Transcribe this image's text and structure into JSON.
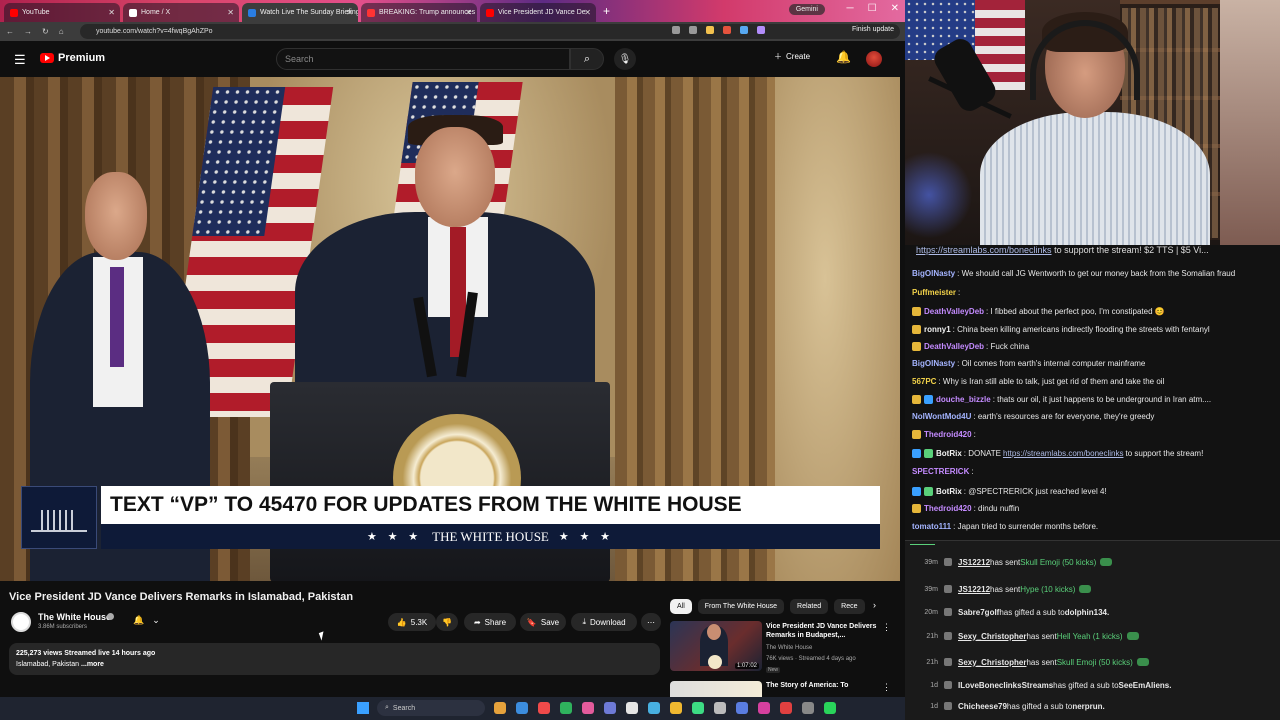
{
  "browser": {
    "tabs": [
      {
        "title": "YouTube",
        "color": "#ff0000"
      },
      {
        "title": "Home / X",
        "color": "#ffffff"
      },
      {
        "title": "Watch Live The Sunday Briefing",
        "color": "#2a7de1"
      },
      {
        "title": "BREAKING: Trump announces",
        "color": "#ff3333"
      },
      {
        "title": "Vice President JD Vance De",
        "color": "#ff0000"
      }
    ],
    "gemini_label": "Gemini",
    "url": "youtube.com/watch?v=4fwqBgAhZPo",
    "finish_update": "Finish update"
  },
  "yt": {
    "brand": "Premium",
    "search_placeholder": "Search",
    "create_label": "Create"
  },
  "video": {
    "lower_third_headline": "TEXT “VP” TO 45470 FOR UPDATES FROM THE WHITE HOUSE",
    "lower_third_sub": "THE WHITE HOUSE",
    "stars": "★ ★ ★"
  },
  "meta": {
    "title": "Vice President JD Vance Delivers Remarks in Islamabad, Pakistan",
    "channel": "The White House",
    "subscribers": "3.86M subscribers",
    "likes": "5.3K",
    "share_label": "Share",
    "save_label": "Save",
    "download_label": "Download",
    "views_line": "225,273 views  Streamed live 14 hours ago",
    "desc_line": "Islamabad, Pakistan",
    "more_label": "...more"
  },
  "related": {
    "chips": [
      "All",
      "From The White House",
      "Related",
      "Rece"
    ],
    "items": [
      {
        "title": "Vice President JD Vance Delivers Remarks in Budapest,...",
        "channel": "The White House",
        "meta": "76K views · Streamed 4 days ago",
        "badge": "New",
        "duration": "1:07:02"
      },
      {
        "title": "The Story of America: To",
        "channel": "",
        "meta": "",
        "badge": "",
        "duration": ""
      }
    ]
  },
  "taskbar": {
    "search_label": "Search",
    "icon_colors": [
      "#e6a23c",
      "#3c8dde",
      "#f04a4a",
      "#2fb25d",
      "#e35b9c",
      "#6e7ad6",
      "#e5e5e5",
      "#48b0e0",
      "#f0b830",
      "#3ddc84",
      "#bbbbbb",
      "#5a7de0",
      "#d6409f",
      "#e04040",
      "#888888",
      "#29d45a"
    ]
  },
  "chat": {
    "banner_link": "https://streamlabs.com/boneclinks",
    "banner_text": " to support the stream! $2 TTS | $5 Vi...",
    "messages": [
      {
        "user": "BigOlNasty",
        "user_color": "#a4b4ff",
        "text": ": We should call JG Wentworth to get our money back from the Somalian fraud",
        "badges": []
      },
      {
        "user": "Puffmeister",
        "user_color": "#f2d24a",
        "text": ":",
        "badges": []
      },
      {
        "user": "DeathValleyDeb",
        "user_color": "#c48bff",
        "text": ": I fibbed about the perfect poo, I'm constipated 😊",
        "badges": [
          "#e6b73a"
        ]
      },
      {
        "user": "ronny1",
        "user_color": "#f2f2f2",
        "text": ": China been killing americans indirectly flooding the streets with fentanyl",
        "badges": [
          "#e6b73a"
        ]
      },
      {
        "user": "DeathValleyDeb",
        "user_color": "#c48bff",
        "text": ": Fuck china",
        "badges": [
          "#e6b73a"
        ]
      },
      {
        "user": "BigOlNasty",
        "user_color": "#a4b4ff",
        "text": ": Oil comes from earth's internal computer mainframe",
        "badges": []
      },
      {
        "user": "567PC",
        "user_color": "#f2d24a",
        "text": ": Why is Iran still able to talk, just get rid of them and take the oil",
        "badges": []
      },
      {
        "user": "douche_bizzle",
        "user_color": "#c48bff",
        "text": ": thats our oil, it just happens to be underground in Iran atm....",
        "badges": [
          "#e6b73a",
          "#3aa0ff"
        ]
      },
      {
        "user": "NoIWontMod4U",
        "user_color": "#a4b4ff",
        "text": ": earth's resources are for everyone, they're greedy",
        "badges": []
      },
      {
        "user": "Thedroid420",
        "user_color": "#c48bff",
        "text": ":",
        "badges": [
          "#e6b73a"
        ]
      },
      {
        "user": "BotRix",
        "user_color": "#f2f2f2",
        "text": ": DONATE ",
        "link": "https://streamlabs.com/boneclinks",
        "after": " to support the stream!",
        "badges": [
          "#3aa0ff",
          "#5ad07a"
        ]
      },
      {
        "user": "SPECTRERICK",
        "user_color": "#c48bff",
        "text": ":",
        "badges": []
      },
      {
        "user": "BotRix",
        "user_color": "#f2f2f2",
        "text": ": @SPECTRERICK just reached level 4!",
        "badges": [
          "#3aa0ff",
          "#5ad07a"
        ]
      },
      {
        "user": "Thedroid420",
        "user_color": "#c48bff",
        "text": ": dindu nuffin",
        "badges": [
          "#e6b73a"
        ]
      },
      {
        "user": "tomato111",
        "user_color": "#a4b4ff",
        "text": ": Japan tried to surrender months before.",
        "badges": []
      }
    ]
  },
  "alerts": [
    {
      "time": "39m",
      "user": "JS12212",
      "text": " has sent ",
      "highlight": "Skull Emoji (50 kicks)",
      "underline": true,
      "kick": true
    },
    {
      "time": "39m",
      "user": "JS12212",
      "text": " has sent ",
      "highlight": "Hype (10 kicks)",
      "underline": true,
      "kick": true
    },
    {
      "time": "20m",
      "user": "Sabre7golf",
      "text": " has gifted a sub to ",
      "highlight": "dolphin134.",
      "underline": false,
      "kick": false
    },
    {
      "time": "21h",
      "user": "Sexy_Christopher",
      "text": " has sent ",
      "highlight": "Hell Yeah (1 kicks)",
      "underline": true,
      "kick": true
    },
    {
      "time": "21h",
      "user": "Sexy_Christopher",
      "text": " has sent ",
      "highlight": "Skull Emoji (50 kicks)",
      "underline": true,
      "kick": true
    },
    {
      "time": "1d",
      "user": "ILoveBoneclinksStreams",
      "text": " has gifted a sub to ",
      "highlight": "SeeEmAliens.",
      "underline": false,
      "kick": false
    },
    {
      "time": "1d",
      "user": "Chicheese79",
      "text": " has gifted a sub to ",
      "highlight": "nerprun.",
      "underline": false,
      "kick": false
    }
  ]
}
